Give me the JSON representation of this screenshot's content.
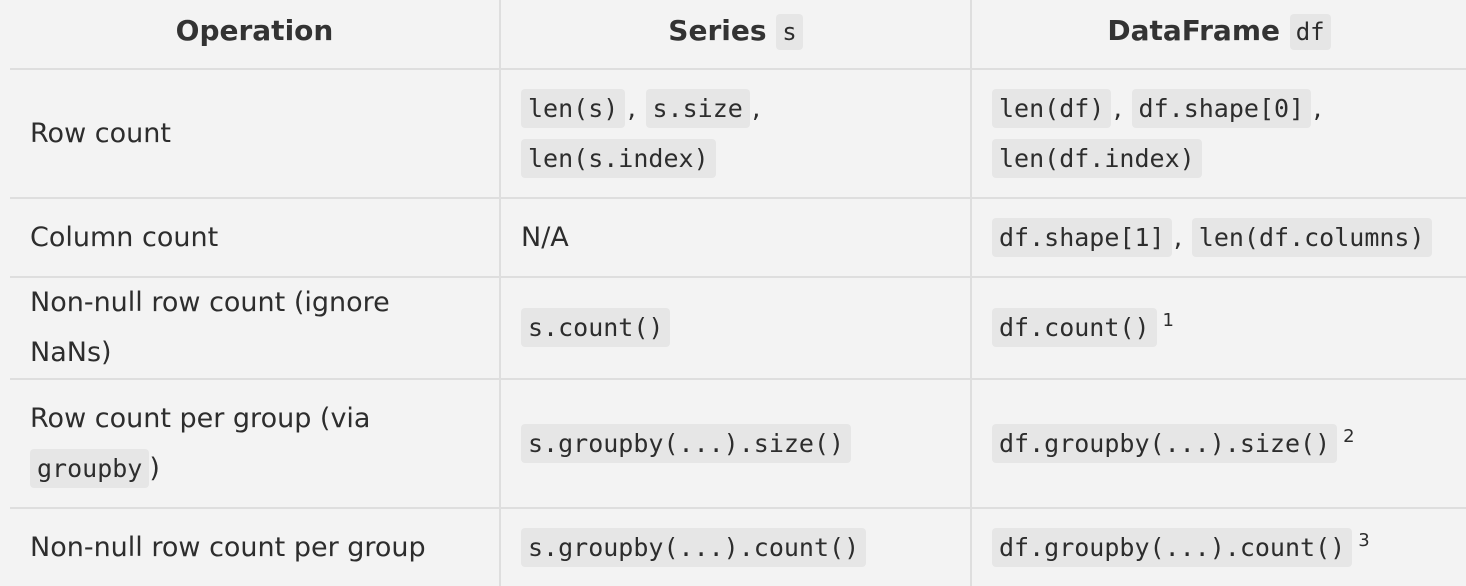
{
  "headers": {
    "operation": "Operation",
    "series_label": "Series",
    "series_code": "s",
    "dataframe_label": "DataFrame",
    "dataframe_code": "df"
  },
  "rows": [
    {
      "operation": "Row count",
      "series": [
        "len(s)",
        "s.size",
        "len(s.index)"
      ],
      "dataframe": [
        "len(df)",
        "df.shape[0]",
        "len(df.index)"
      ]
    },
    {
      "operation": "Column count",
      "series_text": "N/A",
      "dataframe": [
        "df.shape[1]",
        "len(df.columns)"
      ]
    },
    {
      "operation": "Non-null row count (ignore NaNs)",
      "series": [
        "s.count()"
      ],
      "dataframe": [
        "df.count()"
      ],
      "dataframe_footnote": "1"
    },
    {
      "operation_prefix": "Row count per group (via",
      "operation_code": "groupby",
      "operation_suffix": ")",
      "series": [
        "s.groupby(...).size()"
      ],
      "dataframe": [
        "df.groupby(...).size()"
      ],
      "dataframe_footnote": "2"
    },
    {
      "operation": "Non-null row count per group",
      "series": [
        "s.groupby(...).count()"
      ],
      "dataframe": [
        "df.groupby(...).count()"
      ],
      "dataframe_footnote": "3"
    }
  ],
  "separator": ","
}
